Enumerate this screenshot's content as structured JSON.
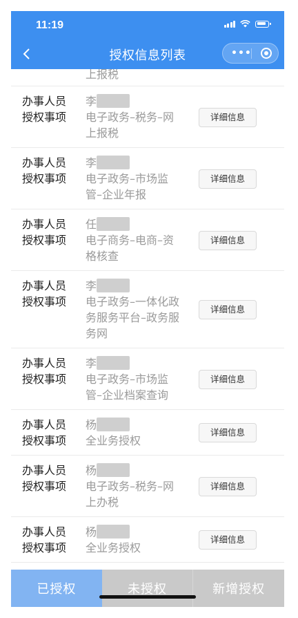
{
  "status_bar": {
    "time": "11:19"
  },
  "nav": {
    "title": "授权信息列表",
    "more_label": "•••"
  },
  "list": {
    "partial_top_text": "上报税",
    "label_person": "办事人员",
    "label_item": "授权事项",
    "detail_label": "详细信息",
    "rows": [
      {
        "surname": "李",
        "item_lines": [
          "电子政务–税务–网",
          "上报税"
        ]
      },
      {
        "surname": "李",
        "item_lines": [
          "电子政务–市场监",
          "管–企业年报"
        ]
      },
      {
        "surname": "任",
        "item_lines": [
          "电子商务–电商–资",
          "格核查"
        ]
      },
      {
        "surname": "李",
        "item_lines": [
          "电子政务–一体化政",
          "务服务平台–政务服",
          "务网"
        ]
      },
      {
        "surname": "李",
        "item_lines": [
          "电子政务–市场监",
          "管–企业档案查询"
        ]
      },
      {
        "surname": "杨",
        "item_lines": [
          "全业务授权"
        ]
      },
      {
        "surname": "杨",
        "item_lines": [
          "电子政务–税务–网",
          "上办税"
        ]
      },
      {
        "surname": "杨",
        "item_lines": [
          "全业务授权"
        ]
      }
    ]
  },
  "tabs": {
    "authorized": "已授权",
    "unauthorized": "未授权",
    "add": "新增授权"
  },
  "colors": {
    "header": "#3d8ff0",
    "active_tab": "#82b4f2",
    "inactive_tab": "#c9c9c9"
  }
}
